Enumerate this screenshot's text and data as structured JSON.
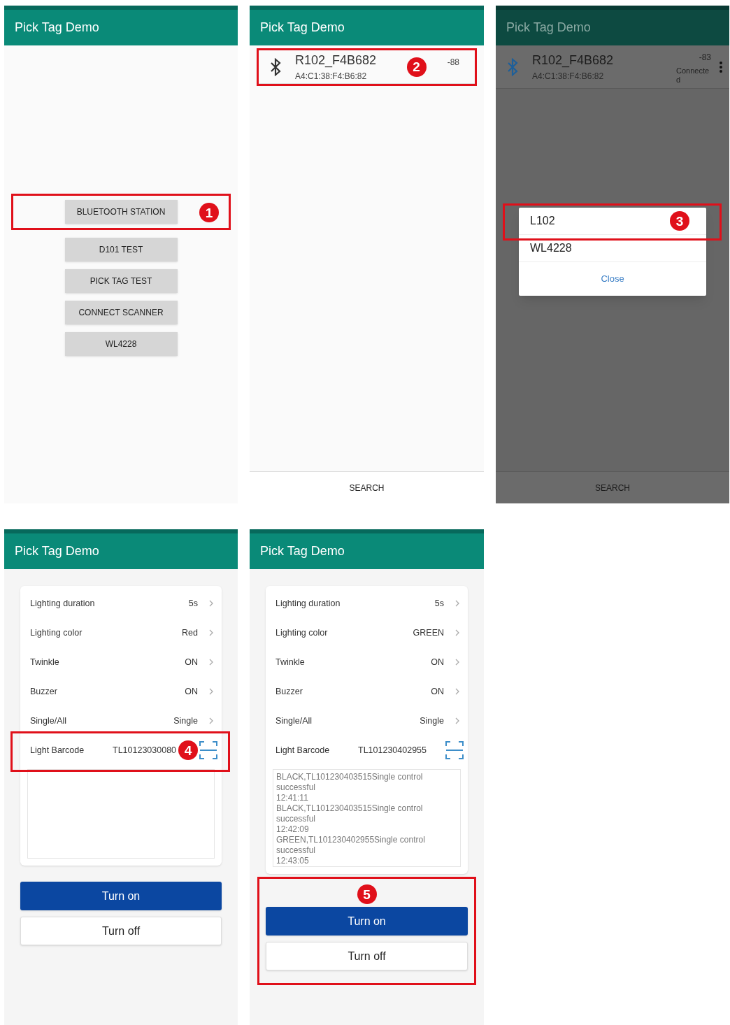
{
  "screens": [
    {
      "kind": "menu",
      "title": "Pick Tag Demo",
      "dimmed": false,
      "buttons": [
        {
          "label": "BLUETOOTH STATION",
          "callout": "1"
        },
        {
          "label": "D101 TEST"
        },
        {
          "label": "PICK TAG TEST"
        },
        {
          "label": "CONNECT SCANNER"
        },
        {
          "label": "WL4228"
        }
      ]
    },
    {
      "kind": "scan",
      "title": "Pick Tag Demo",
      "dimmed": false,
      "devices": [
        {
          "name": "R102_F4B682",
          "address": "A4:C1:38:F4:B6:82",
          "rssi": "-88",
          "callout": "2"
        }
      ],
      "search": "SEARCH"
    },
    {
      "kind": "scan",
      "title": "Pick Tag Demo",
      "dimmed": true,
      "devices": [
        {
          "name": "R102_F4B682",
          "address": "A4:C1:38:F4:B6:82",
          "rssi": "-83",
          "status": "Connected"
        }
      ],
      "search": "SEARCH",
      "dialog": {
        "items": [
          {
            "label": "L102",
            "callout": "3"
          },
          {
            "label": "WL4228"
          }
        ],
        "close": "Close"
      }
    },
    {
      "kind": "control",
      "title": "Pick Tag Demo",
      "dimmed": false,
      "settings": [
        {
          "label": "Lighting duration",
          "value": "5s"
        },
        {
          "label": "Lighting color",
          "value": "Red"
        },
        {
          "label": "Twinkle",
          "value": "ON"
        },
        {
          "label": "Buzzer",
          "value": "ON"
        },
        {
          "label": "Single/All",
          "value": "Single"
        }
      ],
      "barcode": {
        "label": "Light Barcode",
        "value": "TL10123030080",
        "callout": "4"
      },
      "buttons": [
        "Turn on",
        "Turn off"
      ]
    },
    {
      "kind": "control",
      "title": "Pick Tag Demo",
      "dimmed": false,
      "settings": [
        {
          "label": "Lighting duration",
          "value": "5s"
        },
        {
          "label": "Lighting color",
          "value": "GREEN"
        },
        {
          "label": "Twinkle",
          "value": "ON"
        },
        {
          "label": "Buzzer",
          "value": "ON"
        },
        {
          "label": "Single/All",
          "value": "Single"
        }
      ],
      "barcode": {
        "label": "Light Barcode",
        "value": "TL101230402955"
      },
      "log": [
        "BLACK,TL101230403515Single control successful",
        "12:41:11",
        "BLACK,TL101230403515Single control successful",
        "12:42:09",
        "GREEN,TL101230402955Single control successful",
        "12:43:05"
      ],
      "buttons": [
        "Turn on",
        "Turn off"
      ],
      "buttons_callout": "5"
    }
  ]
}
